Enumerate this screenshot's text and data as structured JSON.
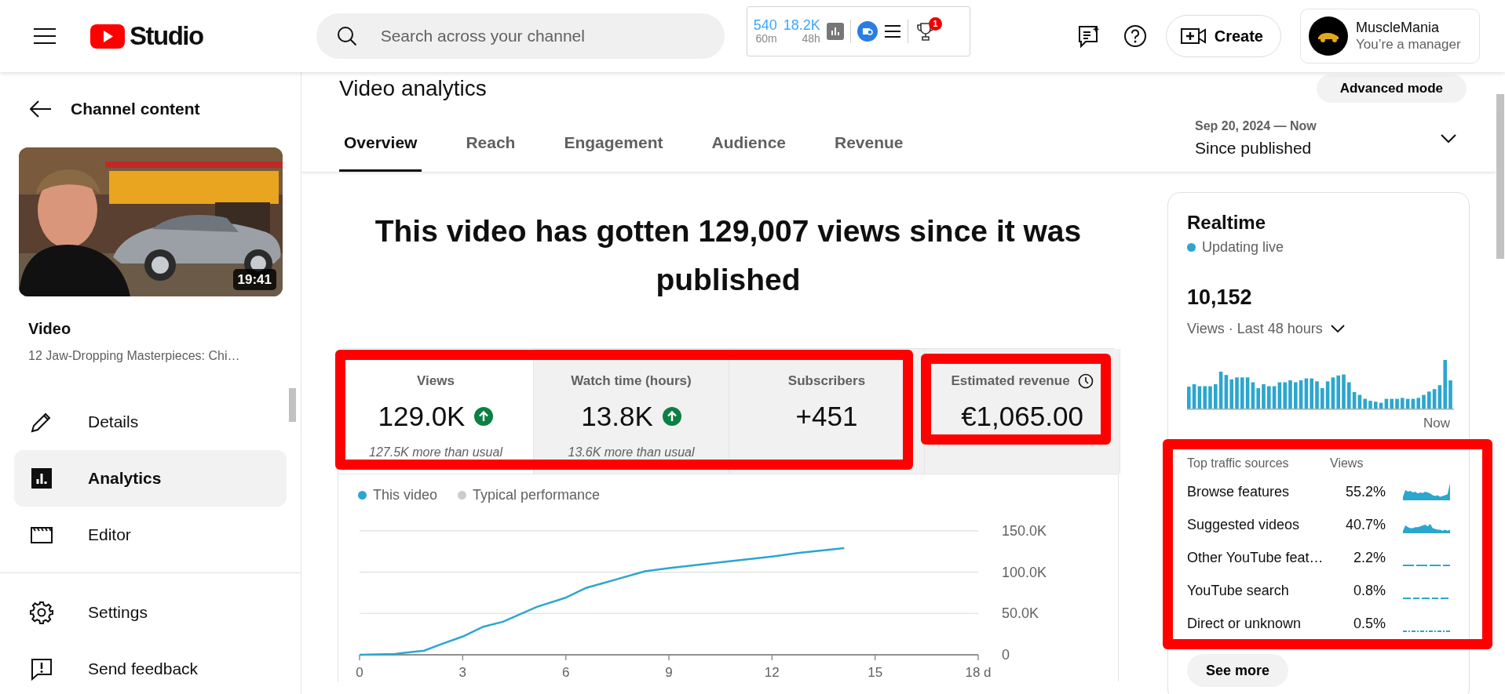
{
  "header": {
    "logo_text": "Studio",
    "search_placeholder": "Search across your channel",
    "extension": {
      "views_60m": "540",
      "label_60m": "60m",
      "views_48h": "18.2K",
      "label_48h": "48h",
      "badge": "1"
    },
    "create_label": "Create",
    "account": {
      "name": "MuscleMania",
      "role": "You’re a manager"
    }
  },
  "sidebar": {
    "back_label": "Channel content",
    "thumbnail": {
      "kind": "picture",
      "duration": "19:41"
    },
    "video_heading": "Video",
    "video_title": "12 Jaw-Dropping Masterpieces: Chi…",
    "items": [
      {
        "label": "Details",
        "kind": "pencil",
        "selected": false
      },
      {
        "label": "Analytics",
        "kind": "analytics",
        "selected": true
      },
      {
        "label": "Editor",
        "kind": "clapper",
        "selected": false
      }
    ],
    "footer_items": [
      {
        "label": "Settings",
        "kind": "gear"
      },
      {
        "label": "Send feedback",
        "kind": "feedback"
      }
    ]
  },
  "page": {
    "title": "Video analytics",
    "advanced_button": "Advanced mode",
    "tabs": [
      {
        "label": "Overview",
        "selected": true
      },
      {
        "label": "Reach",
        "selected": false
      },
      {
        "label": "Engagement",
        "selected": false
      },
      {
        "label": "Audience",
        "selected": false
      },
      {
        "label": "Revenue",
        "selected": false
      }
    ],
    "date_range": {
      "range": "Sep 20, 2024 — Now",
      "label": "Since published"
    },
    "headline": "This video has gotten 129,007 views since it was published",
    "metric_groups": [
      {
        "highlighted": true,
        "metrics": [
          {
            "label": "Views",
            "value": "129.0K",
            "trend_up": true,
            "note": "127.5K more than usual",
            "selected": true
          },
          {
            "label": "Watch time (hours)",
            "value": "13.8K",
            "trend_up": true,
            "note": "13.6K more than usual",
            "selected": false
          },
          {
            "label": "Subscribers",
            "value": "+451",
            "trend_up": false,
            "selected": false
          }
        ]
      },
      {
        "highlighted": true,
        "metrics": [
          {
            "label": "Estimated revenue",
            "value": "€1,065.00",
            "trend_up": false,
            "selected": false
          }
        ]
      }
    ],
    "views_chart": {
      "chart_data": {
        "type": "line",
        "x": [
          0,
          1.03,
          1.88,
          2.38,
          3.0,
          3.6,
          4.17,
          5.16,
          5.99,
          6.59,
          7.45,
          8.3,
          9.0,
          10.3,
          12.0,
          12.9,
          14.1
        ],
        "series": [
          {
            "name": "This video",
            "color": "#2ba6cf",
            "values": [
              0,
              1000,
              5000,
              13000,
              22000,
              34000,
              40000,
              58000,
              69000,
              81000,
              91000,
              101000,
              105000,
              111000,
              119000,
              124000,
              129000
            ]
          },
          {
            "name": "Typical performance",
            "color": "#cccccc",
            "values": [
              null,
              null,
              null,
              null,
              null,
              null,
              null,
              null,
              null,
              null,
              null,
              null,
              null,
              null,
              null,
              null,
              null
            ]
          }
        ],
        "xlim": [
          0,
          18
        ],
        "ylim": [
          0,
          150000
        ],
        "xticks": [
          0,
          3,
          6,
          9,
          12,
          15,
          {
            "value": 18,
            "label": "18 d"
          }
        ],
        "yticks": [
          {
            "value": 0,
            "label": "0"
          },
          {
            "value": 50000,
            "label": "50.0K"
          },
          {
            "value": 100000,
            "label": "100.0K"
          },
          {
            "value": 150000,
            "label": "150.0K"
          }
        ]
      }
    }
  },
  "realtime": {
    "title": "Realtime",
    "status": "Updating live",
    "count": "10,152",
    "period": "Views · Last 48 hours",
    "axis_label": "Now",
    "see_more": "See more",
    "traffic": {
      "highlighted": true,
      "columns": [
        "Top traffic sources",
        "Views"
      ],
      "rows": [
        {
          "source": "Browse features",
          "share": "55.2%"
        },
        {
          "source": "Suggested videos",
          "share": "40.7%"
        },
        {
          "source": "Other YouTube feat…",
          "share": "2.2%"
        },
        {
          "source": "YouTube search",
          "share": "0.8%"
        },
        {
          "source": "Direct or unknown",
          "share": "0.5%"
        }
      ]
    }
  }
}
